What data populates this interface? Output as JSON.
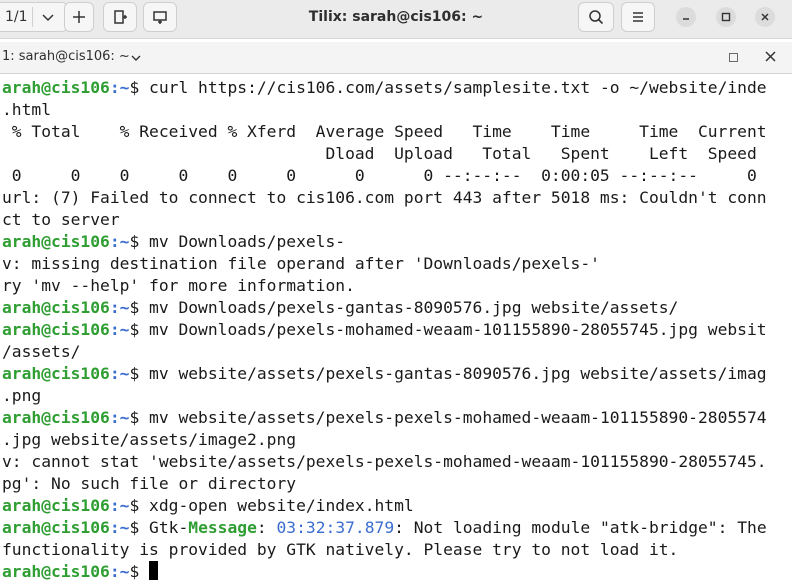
{
  "header": {
    "pager": "1/1",
    "title": "Tilix: sarah@cis106: ~"
  },
  "session": {
    "label": "1: sarah@cis106: ~"
  },
  "terminal": {
    "user": "arah@cis106",
    "path": ":~",
    "lines": [
      {
        "kind": "cmd",
        "text": "$ curl https://cis106.com/assets/samplesite.txt -o ~/website/inde"
      },
      {
        "kind": "out",
        "text": ".html"
      },
      {
        "kind": "out",
        "text": " % Total    % Received % Xferd  Average Speed   Time    Time     Time  Current"
      },
      {
        "kind": "out",
        "text": "                                 Dload  Upload   Total   Spent    Left  Speed"
      },
      {
        "kind": "out",
        "text": " 0     0    0     0    0     0      0      0 --:--:--  0:00:05 --:--:--     0"
      },
      {
        "kind": "out",
        "text": "url: (7) Failed to connect to cis106.com port 443 after 5018 ms: Couldn't conn"
      },
      {
        "kind": "out",
        "text": "ct to server"
      },
      {
        "kind": "cmd",
        "text": "$ mv Downloads/pexels-"
      },
      {
        "kind": "out",
        "text": "v: missing destination file operand after 'Downloads/pexels-'"
      },
      {
        "kind": "out",
        "text": "ry 'mv --help' for more information."
      },
      {
        "kind": "cmd",
        "text": "$ mv Downloads/pexels-gantas-8090576.jpg website/assets/"
      },
      {
        "kind": "cmd",
        "text": "$ mv Downloads/pexels-mohamed-weaam-101155890-28055745.jpg websit"
      },
      {
        "kind": "out",
        "text": "/assets/"
      },
      {
        "kind": "cmd",
        "text": "$ mv website/assets/pexels-gantas-8090576.jpg website/assets/imag"
      },
      {
        "kind": "out",
        "text": ".png"
      },
      {
        "kind": "cmd",
        "text": "$ mv website/assets/pexels-pexels-mohamed-weaam-101155890-2805574"
      },
      {
        "kind": "out",
        "text": ".jpg website/assets/image2.png"
      },
      {
        "kind": "out",
        "text": "v: cannot stat 'website/assets/pexels-pexels-mohamed-weaam-101155890-28055745."
      },
      {
        "kind": "out",
        "text": "pg': No such file or directory"
      },
      {
        "kind": "cmd",
        "text": "$ xdg-open website/index.html"
      },
      {
        "kind": "gtk",
        "pre": "$ Gtk-",
        "msg": "Message",
        "colon": ": ",
        "time": "03:32:37.879",
        "rest": ": Not loading module \"atk-bridge\": The"
      },
      {
        "kind": "out",
        "text": "functionality is provided by GTK natively. Please try to not load it."
      },
      {
        "kind": "prompt",
        "text": "$ "
      }
    ]
  }
}
